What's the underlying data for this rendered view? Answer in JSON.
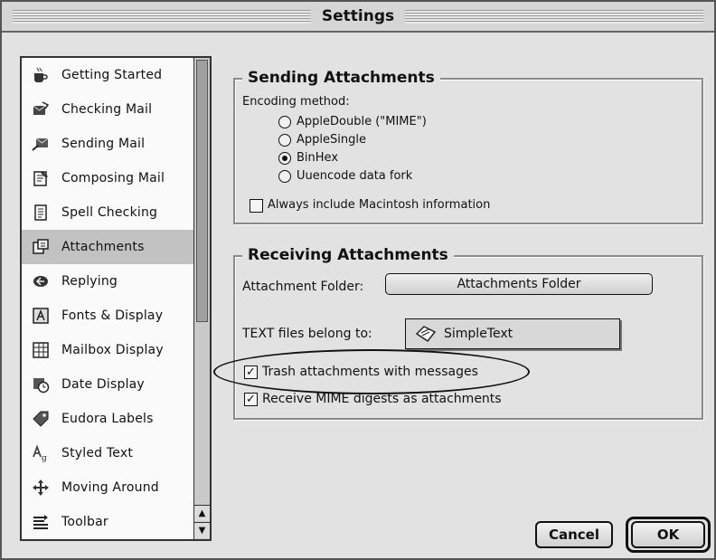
{
  "window": {
    "title": "Settings"
  },
  "sidebar": {
    "items": [
      {
        "label": "Getting Started",
        "icon": "coffee-cup-icon"
      },
      {
        "label": "Checking Mail",
        "icon": "check-mail-icon"
      },
      {
        "label": "Sending Mail",
        "icon": "send-mail-icon"
      },
      {
        "label": "Composing Mail",
        "icon": "compose-icon"
      },
      {
        "label": "Spell Checking",
        "icon": "spell-check-icon"
      },
      {
        "label": "Attachments",
        "icon": "attachment-icon",
        "selected": true
      },
      {
        "label": "Replying",
        "icon": "reply-icon"
      },
      {
        "label": "Fonts & Display",
        "icon": "font-icon"
      },
      {
        "label": "Mailbox Display",
        "icon": "mailbox-icon"
      },
      {
        "label": "Date Display",
        "icon": "clock-icon"
      },
      {
        "label": "Eudora Labels",
        "icon": "label-icon"
      },
      {
        "label": "Styled Text",
        "icon": "styled-text-icon"
      },
      {
        "label": "Moving Around",
        "icon": "move-icon"
      },
      {
        "label": "Toolbar",
        "icon": "toolbar-icon"
      }
    ]
  },
  "sending": {
    "title": "Sending Attachments",
    "encoding_label": "Encoding method:",
    "options": [
      {
        "label": "AppleDouble (\"MIME\")",
        "checked": false
      },
      {
        "label": "AppleSingle",
        "checked": false
      },
      {
        "label": "BinHex",
        "checked": true
      },
      {
        "label": "Uuencode data fork",
        "checked": false
      }
    ],
    "mac_info_label": "Always include Macintosh information",
    "mac_info_checked": false
  },
  "receiving": {
    "title": "Receiving Attachments",
    "folder_label": "Attachment Folder:",
    "folder_button": "Attachments Folder",
    "text_files_label": "TEXT files belong to:",
    "text_files_app": "SimpleText",
    "trash_label": "Trash attachments with messages",
    "trash_checked": true,
    "mime_label": "Receive MIME digests as attachments",
    "mime_checked": true
  },
  "buttons": {
    "cancel": "Cancel",
    "ok": "OK"
  }
}
